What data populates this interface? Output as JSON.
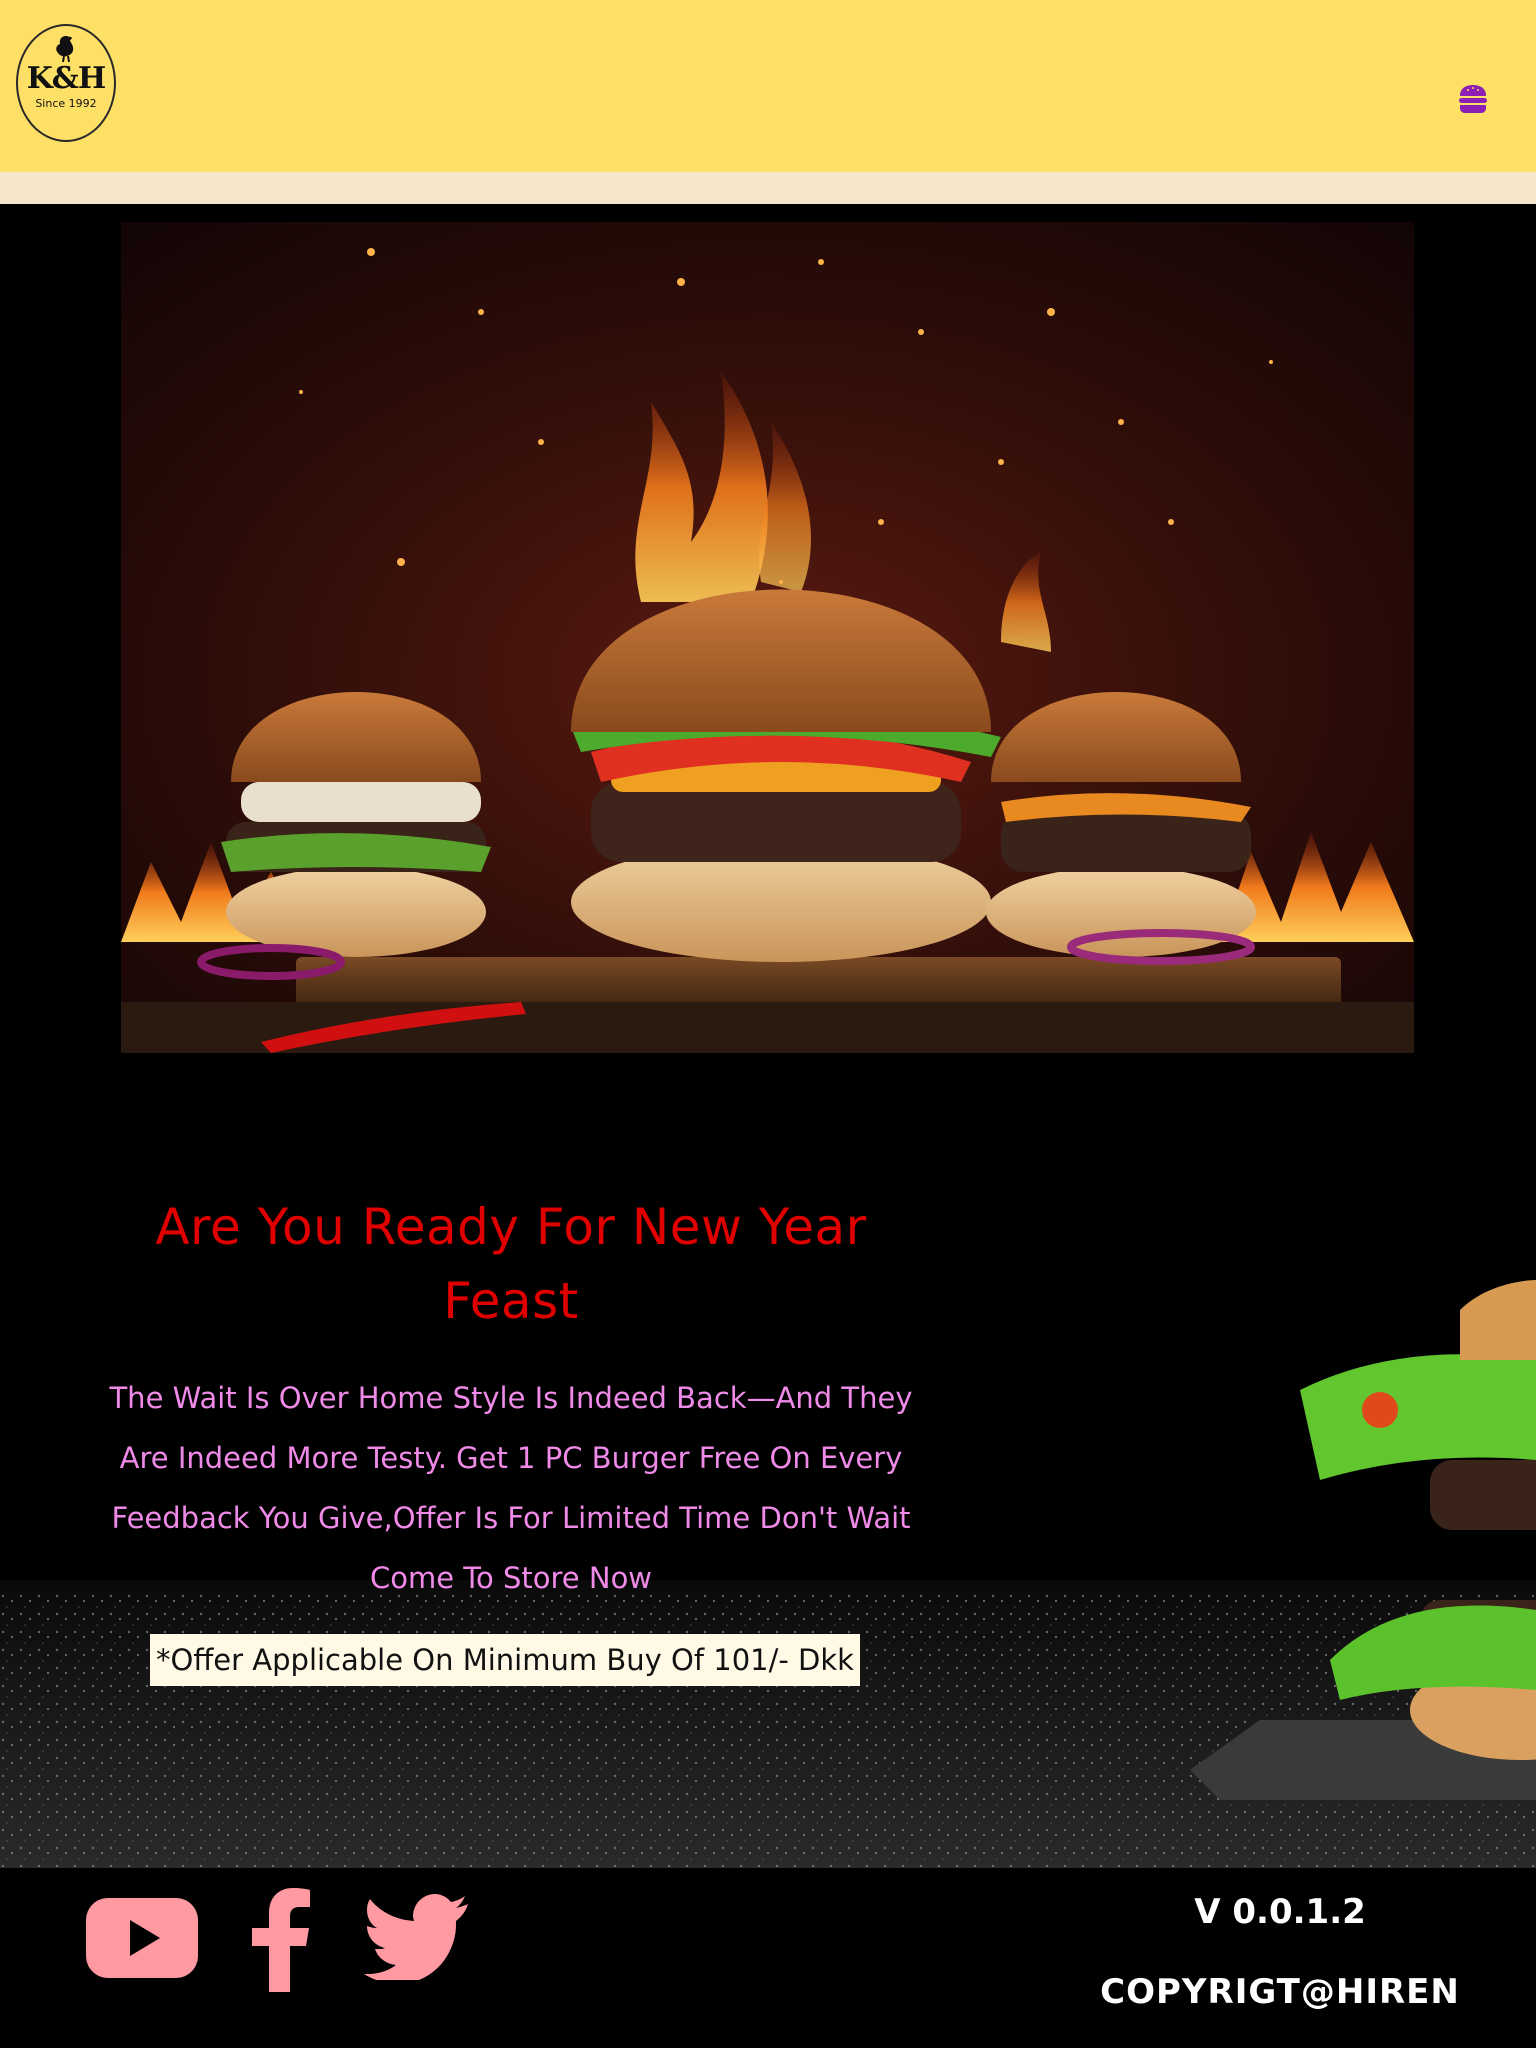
{
  "header": {
    "logo": {
      "brand": "K&H",
      "since": "Since 1992"
    },
    "menu_icon": "burger-menu-icon"
  },
  "hero": {
    "image": "burgers-on-fire"
  },
  "promo": {
    "title": "Are You Ready For New Year Feast",
    "text": "The Wait Is Over Home Style Is Indeed Back—And They Are Indeed More Testy. Get 1 PC Burger Free On Every Feedback You Give,Offer Is For Limited Time Don't Wait Come To Store Now",
    "note": "*Offer Applicable On Minimum Buy Of 101/- Dkk"
  },
  "footer": {
    "social": [
      "youtube-icon",
      "facebook-icon",
      "twitter-icon"
    ],
    "version": "V 0.0.1.2",
    "copyright": "COPYRIGT@HIREN"
  },
  "colors": {
    "header_bg": "#ffe066",
    "stripe": "#f5e6cc",
    "title": "#e10000",
    "text": "#f08ae8",
    "social": "#ff9aa2",
    "menu": "#8e1fb5"
  }
}
